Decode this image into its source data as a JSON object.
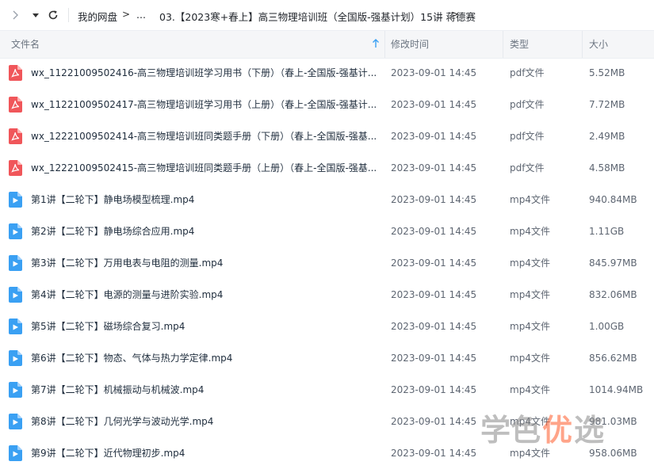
{
  "topbar": {
    "breadcrumb_root": "我的网盘",
    "ellipsis": "...",
    "breadcrumb_current": "03.【2023寒+春上】高三物理培训班（全国版-强基计划）15讲 蒋德赛",
    "sep": ">"
  },
  "header": {
    "name_label": "文件名",
    "date_label": "修改时间",
    "type_label": "类型",
    "size_label": "大小"
  },
  "files": [
    {
      "name": "wx_11221009502416-高三物理培训班学习用书（下册）（春上-全国版-强基计...",
      "date": "2023-09-01 14:45",
      "type": "pdf文件",
      "size": "5.52MB",
      "kind": "pdf"
    },
    {
      "name": "wx_11221009502417-高三物理培训班学习用书（上册）（春上-全国版-强基计...",
      "date": "2023-09-01 14:45",
      "type": "pdf文件",
      "size": "7.72MB",
      "kind": "pdf"
    },
    {
      "name": "wx_12221009502414-高三物理培训班同类题手册（下册）（春上-全国版-强基...",
      "date": "2023-09-01 14:45",
      "type": "pdf文件",
      "size": "2.49MB",
      "kind": "pdf"
    },
    {
      "name": "wx_12221009502415-高三物理培训班同类题手册（上册）（春上-全国版-强基...",
      "date": "2023-09-01 14:45",
      "type": "pdf文件",
      "size": "4.58MB",
      "kind": "pdf"
    },
    {
      "name": "第1讲【二轮下】静电场模型梳理.mp4",
      "date": "2023-09-01 14:45",
      "type": "mp4文件",
      "size": "940.84MB",
      "kind": "video"
    },
    {
      "name": "第2讲【二轮下】静电场综合应用.mp4",
      "date": "2023-09-01 14:45",
      "type": "mp4文件",
      "size": "1.11GB",
      "kind": "video"
    },
    {
      "name": "第3讲【二轮下】万用电表与电阻的测量.mp4",
      "date": "2023-09-01 14:45",
      "type": "mp4文件",
      "size": "845.97MB",
      "kind": "video"
    },
    {
      "name": "第4讲【二轮下】电源的测量与进阶实验.mp4",
      "date": "2023-09-01 14:45",
      "type": "mp4文件",
      "size": "832.06MB",
      "kind": "video"
    },
    {
      "name": "第5讲【二轮下】磁场综合复习.mp4",
      "date": "2023-09-01 14:45",
      "type": "mp4文件",
      "size": "1.00GB",
      "kind": "video"
    },
    {
      "name": "第6讲【二轮下】物态、气体与热力学定律.mp4",
      "date": "2023-09-01 14:45",
      "type": "mp4文件",
      "size": "856.62MB",
      "kind": "video"
    },
    {
      "name": "第7讲【二轮下】机械振动与机械波.mp4",
      "date": "2023-09-01 14:45",
      "type": "mp4文件",
      "size": "1014.94MB",
      "kind": "video"
    },
    {
      "name": "第8讲【二轮下】几何光学与波动光学.mp4",
      "date": "2023-09-01 14:45",
      "type": "mp4文件",
      "size": "981.03MB",
      "kind": "video"
    },
    {
      "name": "第9讲【二轮下】近代物理初步.mp4",
      "date": "2023-09-01 14:45",
      "type": "mp4文件",
      "size": "958.06MB",
      "kind": "video"
    }
  ],
  "watermark": {
    "part1": "学色",
    "part2": "优",
    "part3": "选"
  },
  "colors": {
    "pdf": "#f0565a",
    "video": "#3aa0f3",
    "header_bg": "#f5f6f8",
    "watermark_accent": "#ff5a2a"
  },
  "icons": {
    "pdf": "pdf-file-icon",
    "video": "video-file-icon"
  }
}
